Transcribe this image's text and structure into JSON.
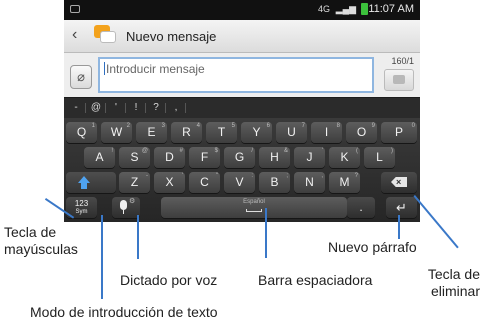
{
  "status_bar": {
    "time": "11:07 AM",
    "signal_glyph": "4G",
    "signal_bars": "▂▄▆"
  },
  "title_bar": {
    "back_glyph": "‹",
    "title": "Nuevo mensaje"
  },
  "compose": {
    "placeholder": "Introducir mensaje",
    "char_counter": "160/1",
    "attach_glyph": "⌀"
  },
  "symbol_row": [
    "-",
    "@",
    "'",
    "!",
    "?",
    ","
  ],
  "keyboard": {
    "row1": [
      {
        "label": "Q",
        "sub": "1"
      },
      {
        "label": "W",
        "sub": "2"
      },
      {
        "label": "E",
        "sub": "3"
      },
      {
        "label": "R",
        "sub": "4"
      },
      {
        "label": "T",
        "sub": "5"
      },
      {
        "label": "Y",
        "sub": "6"
      },
      {
        "label": "U",
        "sub": "7"
      },
      {
        "label": "I",
        "sub": "8"
      },
      {
        "label": "O",
        "sub": "9"
      },
      {
        "label": "P",
        "sub": "0"
      }
    ],
    "row2": [
      {
        "label": "A",
        "sub": "!"
      },
      {
        "label": "S",
        "sub": "@"
      },
      {
        "label": "D",
        "sub": "#"
      },
      {
        "label": "F",
        "sub": "$"
      },
      {
        "label": "G",
        "sub": "/"
      },
      {
        "label": "H",
        "sub": "&"
      },
      {
        "label": "J",
        "sub": "'"
      },
      {
        "label": "K",
        "sub": "("
      },
      {
        "label": "L",
        "sub": ")"
      }
    ],
    "row3": [
      {
        "label": "Z",
        "sub": "-"
      },
      {
        "label": "X",
        "sub": "'"
      },
      {
        "label": "C",
        "sub": "\""
      },
      {
        "label": "V",
        "sub": ":"
      },
      {
        "label": "B",
        "sub": ";"
      },
      {
        "label": "N",
        "sub": ","
      },
      {
        "label": "M",
        "sub": "?"
      }
    ],
    "mode_key": {
      "top": "123",
      "bottom": "Sym"
    },
    "space_label": "Español",
    "period_key": ".",
    "mic_gear": "⚙",
    "enter_glyph": "↵"
  },
  "callouts": {
    "shift": "Tecla de\nmayúsculas",
    "voice": "Dictado por voz",
    "space": "Barra espaciadora",
    "enter": "Nuevo párrafo",
    "delete": "Tecla de\neliminar",
    "input_mode": "Modo de introducción de texto"
  },
  "colors": {
    "callout": "#3a78c8",
    "shift_arrow": "#4fa3f0",
    "keyboard_bg": "#262626"
  }
}
